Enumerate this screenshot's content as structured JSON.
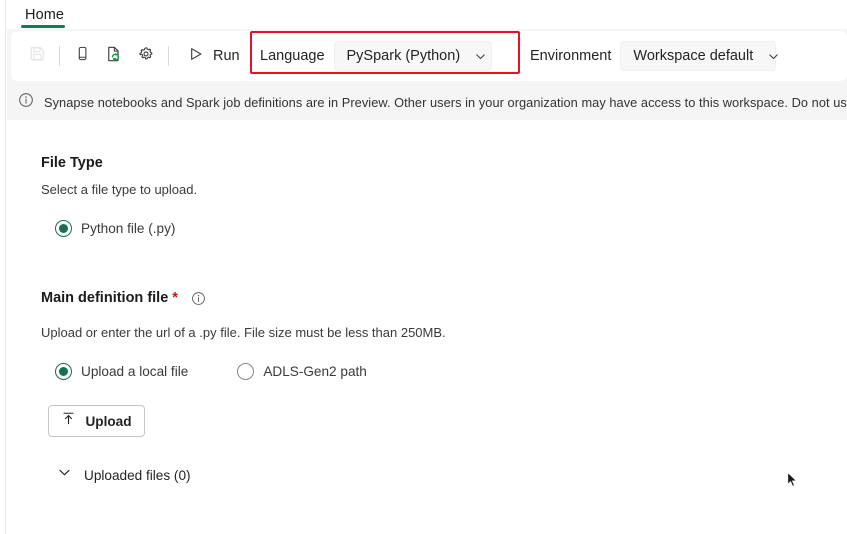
{
  "window": {
    "background": "#ffffff",
    "accent_green": "#107c5a",
    "highlight_color": "#e81123"
  },
  "tabstrip": {
    "tabs": [
      {
        "label": "Home",
        "selected": true,
        "name": "tab-home"
      }
    ]
  },
  "toolbar": {
    "buttons": [
      {
        "name": "save-button",
        "icon": "save-icon",
        "label": "Save",
        "disabled": true
      },
      {
        "name": "mobile-view-button",
        "icon": "mobile-icon",
        "label": "Mobile view",
        "disabled": false
      },
      {
        "name": "publish-button",
        "icon": "publish-refresh-icon",
        "label": "Publish",
        "disabled": false
      },
      {
        "name": "settings-button",
        "icon": "gear-icon",
        "label": "Settings",
        "disabled": false
      }
    ],
    "run": {
      "label": "Run",
      "icon": "play-triangle-icon"
    },
    "language": {
      "label": "Language",
      "value": "PySpark (Python)",
      "chevron": "chevron-down-icon"
    },
    "environment": {
      "label": "Environment",
      "value": "Workspace default",
      "chevron": "chevron-down-icon"
    }
  },
  "banner": {
    "icon": "info-circle-icon",
    "message": "Synapse notebooks and Spark job definitions are in Preview. Other users in your organization may have access to this workspace. Do not use these items"
  },
  "main": {
    "file_type": {
      "title": "File Type",
      "description": "Select a file type to upload.",
      "options": [
        {
          "label": "Python file (.py)",
          "selected": true,
          "name": "radio-python-file"
        }
      ]
    },
    "main_definition_file": {
      "title": "Main definition file",
      "required_marker": "*",
      "info_icon": "info-circle-icon",
      "description": "Upload or enter the url of a .py file. File size must be less than 250MB.",
      "options": [
        {
          "label": "Upload a local file",
          "selected": true,
          "name": "radio-upload-local-file"
        },
        {
          "label": "ADLS-Gen2 path",
          "selected": false,
          "name": "radio-adls-gen2-path"
        }
      ],
      "upload_button": {
        "label": "Upload",
        "icon": "upload-arrow-icon"
      },
      "uploaded_files": {
        "label": "Uploaded files (0)",
        "chevron": "chevron-down-icon",
        "expanded": false
      }
    }
  }
}
